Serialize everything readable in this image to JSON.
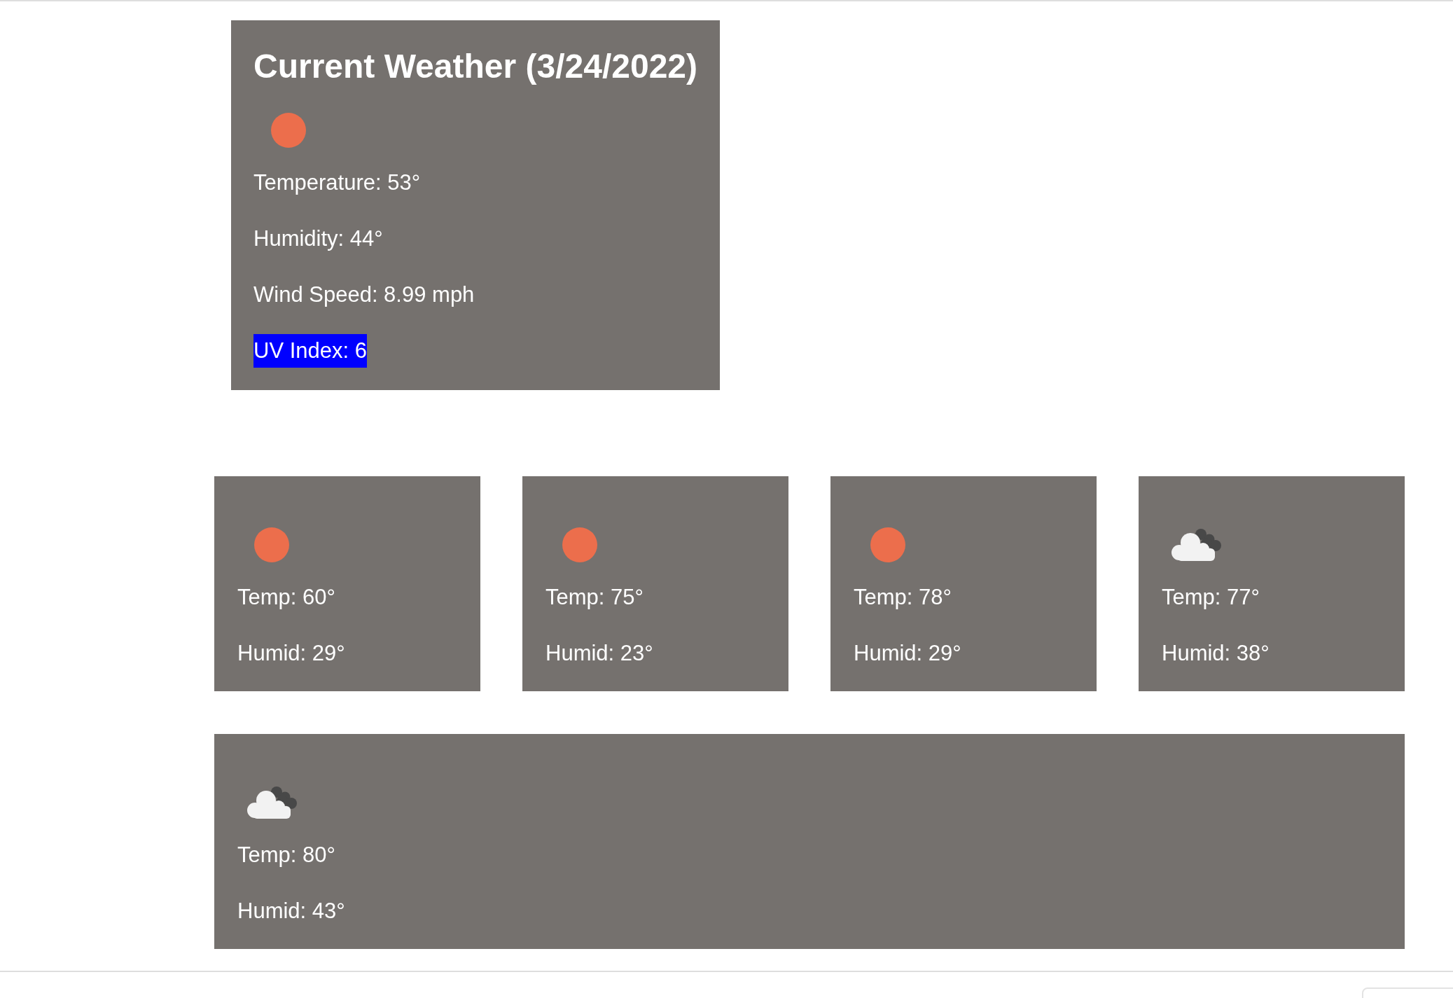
{
  "current": {
    "title": "Current Weather (3/24/2022)",
    "kind": "clear",
    "temperature": "Temperature: 53°",
    "humidity": "Humidity: 44°",
    "wind_speed": "Wind Speed: 8.99 mph",
    "uv_index": "UV Index: 6"
  },
  "forecast": [
    {
      "kind": "clear",
      "temp": "Temp: 60°",
      "humid": "Humid: 29°"
    },
    {
      "kind": "clear",
      "temp": "Temp: 75°",
      "humid": "Humid: 23°"
    },
    {
      "kind": "clear",
      "temp": "Temp: 78°",
      "humid": "Humid: 29°"
    },
    {
      "kind": "clouds",
      "temp": "Temp: 77°",
      "humid": "Humid: 38°"
    },
    {
      "kind": "clouds",
      "temp": "Temp: 80°",
      "humid": "Humid: 43°"
    }
  ]
}
